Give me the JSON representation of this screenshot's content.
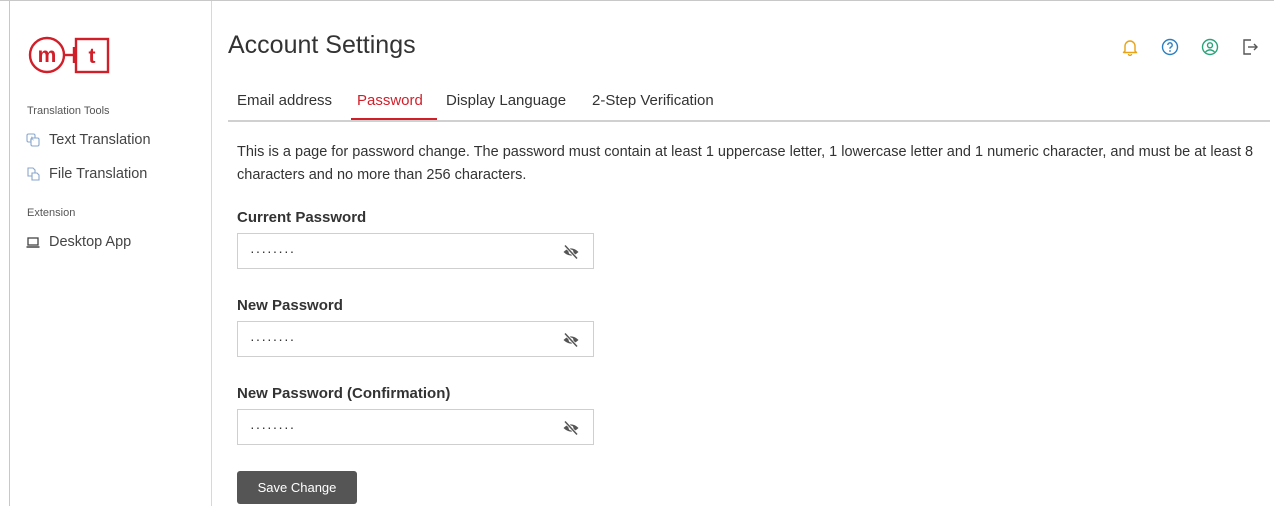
{
  "brand": {
    "logo_left": "m",
    "logo_right": "t",
    "accent_color": "#d11f2a"
  },
  "sidebar": {
    "sections": [
      {
        "title": "Translation Tools",
        "items": [
          {
            "label": "Text Translation",
            "icon": "text-translation-icon"
          },
          {
            "label": "File Translation",
            "icon": "file-translation-icon"
          }
        ]
      },
      {
        "title": "Extension",
        "items": [
          {
            "label": "Desktop App",
            "icon": "laptop-icon"
          }
        ]
      }
    ]
  },
  "header": {
    "title": "Account Settings",
    "icons": [
      "bell-icon",
      "help-icon",
      "user-icon",
      "logout-icon"
    ],
    "icon_colors": {
      "bell": "#e8a317",
      "help": "#2a7fc1",
      "user": "#2aa37a",
      "logout": "#555555"
    }
  },
  "tabs": [
    {
      "label": "Email address",
      "active": false
    },
    {
      "label": "Password",
      "active": true
    },
    {
      "label": "Display Language",
      "active": false
    },
    {
      "label": "2-Step Verification",
      "active": false
    }
  ],
  "description": "This is a page for password change. The password must contain at least 1 uppercase letter, 1 lowercase letter and 1 numeric character, and must be at least 8 characters and no more than 256 characters.",
  "form": {
    "current_password": {
      "label": "Current Password",
      "value": "········"
    },
    "new_password": {
      "label": "New Password",
      "value": "········"
    },
    "confirm_password": {
      "label": "New Password (Confirmation)",
      "value": "········"
    },
    "save_label": "Save Change"
  }
}
